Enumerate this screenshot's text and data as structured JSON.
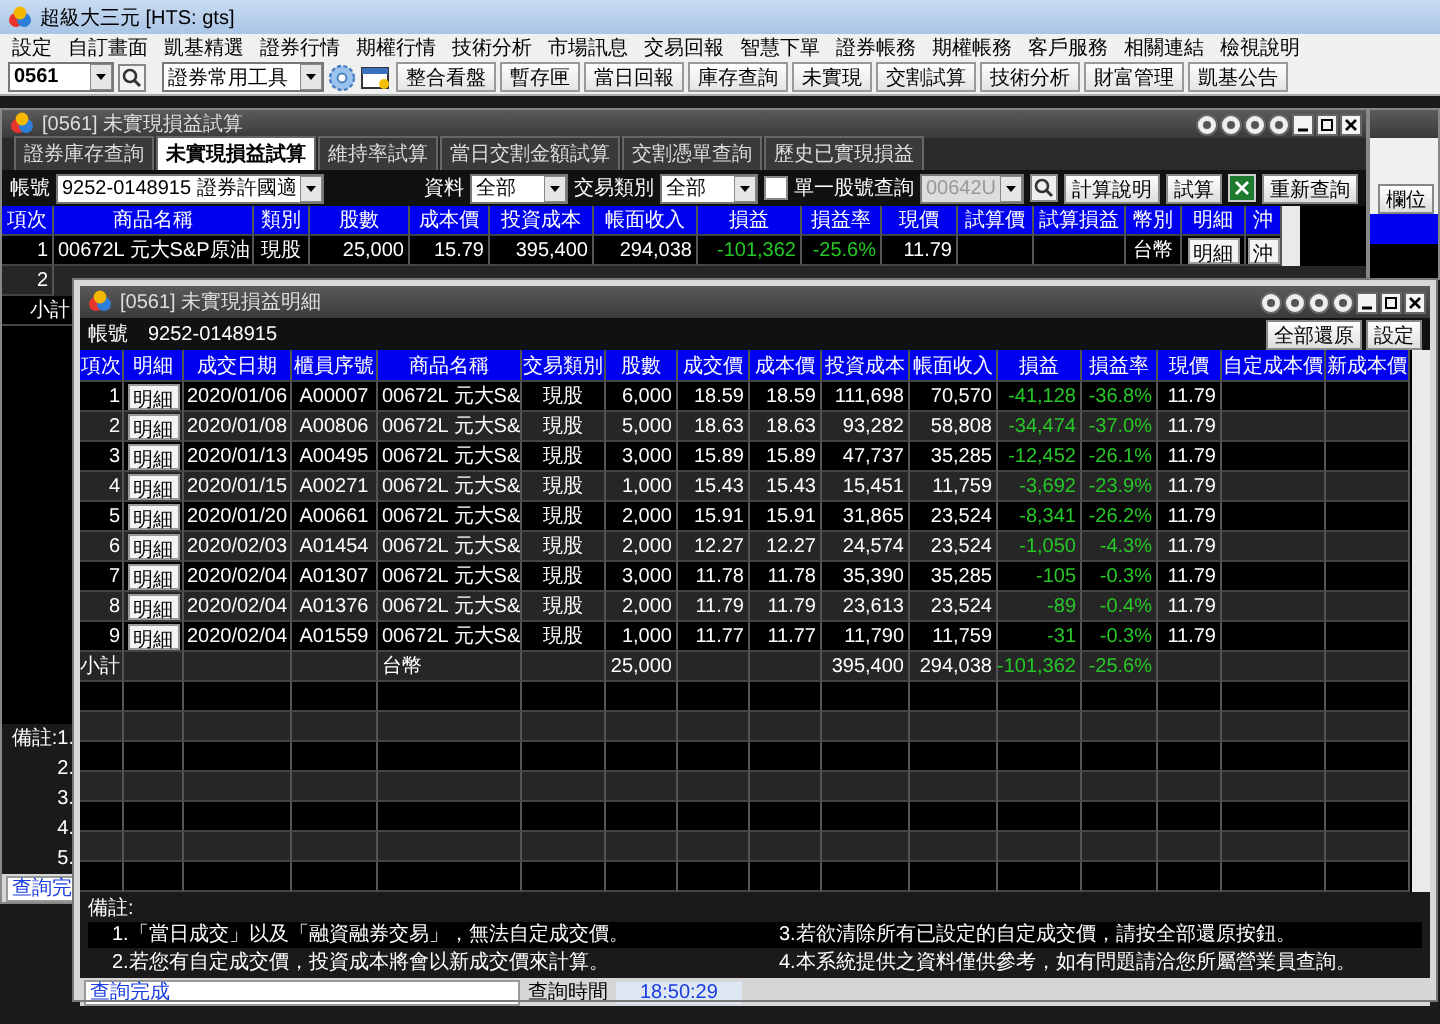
{
  "app": {
    "title": "超級大三元 [HTS: gts]"
  },
  "menu": [
    "設定",
    "自訂畫面",
    "凱基精選",
    "證券行情",
    "期權行情",
    "技術分析",
    "市場訊息",
    "交易回報",
    "智慧下單",
    "證券帳務",
    "期權帳務",
    "客戶服務",
    "相關連結",
    "檢視說明"
  ],
  "toolbar": {
    "account_combo": "0561",
    "tool_combo": "證券常用工具",
    "buttons": [
      "整合看盤",
      "暫存匣",
      "當日回報",
      "庫存查詢",
      "未實現",
      "交割試算",
      "技術分析",
      "財富管理",
      "凱基公告"
    ]
  },
  "back_window": {
    "title": "[0561] 未實現損益試算",
    "tabs": [
      {
        "label": "證券庫存查詢",
        "selected": false
      },
      {
        "label": "未實現損益試算",
        "selected": true
      },
      {
        "label": "維持率試算",
        "selected": false
      },
      {
        "label": "當日交割金額試算",
        "selected": false
      },
      {
        "label": "交割憑單查詢",
        "selected": false
      },
      {
        "label": "歷史已實現損益",
        "selected": false
      }
    ],
    "filters": {
      "account_label": "帳號",
      "account": "9252-0148915 證券許國適",
      "data_label": "資料",
      "data": "全部",
      "type_label": "交易類別",
      "type": "全部",
      "single_query": {
        "label": "單一股號查詢",
        "checked": false
      },
      "stock": {
        "value": "00642U",
        "disabled": true
      },
      "buttons": [
        "計算說明",
        "試算",
        "重新查詢"
      ]
    },
    "table": {
      "columns": [
        "項次",
        "商品名稱",
        "類別",
        "股數",
        "成本價",
        "投資成本",
        "帳面收入",
        "損益",
        "損益率",
        "現價",
        "試算價",
        "試算損益",
        "幣別",
        "明細",
        "沖"
      ],
      "rows": [
        {
          "cells": [
            "1",
            "00672L 元大S&P原油",
            "現股",
            "25,000",
            "15.79",
            "395,400",
            "294,038",
            "-101,362",
            "-25.6%",
            "11.79",
            "",
            "",
            "台幣"
          ],
          "detail_button": "明細",
          "offset_button": "沖"
        }
      ],
      "hidden_row_no": "2",
      "subtotal_label": "小計"
    },
    "notes": [
      "備註:1.",
      "2.",
      "3.",
      "4.",
      "5."
    ],
    "status": "查詢完"
  },
  "side_window": {
    "button": "欄位"
  },
  "detail_window": {
    "title": "[0561] 未實現損益明細",
    "account_label": "帳號",
    "account": "9252-0148915",
    "buttons": [
      "全部還原",
      "設定"
    ],
    "table": {
      "columns": [
        "項次",
        "明細",
        "成交日期",
        "櫃員序號",
        "商品名稱",
        "交易類別",
        "股數",
        "成交價",
        "成本價",
        "投資成本",
        "帳面收入",
        "損益",
        "損益率",
        "現價",
        "自定成本價",
        "新成本價"
      ],
      "rows": [
        {
          "cells": [
            "1",
            "明細",
            "2020/01/06",
            "A00007",
            "00672L 元大S&",
            "現股",
            "6,000",
            "18.59",
            "18.59",
            "111,698",
            "70,570",
            "-41,128",
            "-36.8%",
            "11.79",
            "",
            ""
          ]
        },
        {
          "cells": [
            "2",
            "明細",
            "2020/01/08",
            "A00806",
            "00672L 元大S&",
            "現股",
            "5,000",
            "18.63",
            "18.63",
            "93,282",
            "58,808",
            "-34,474",
            "-37.0%",
            "11.79",
            "",
            ""
          ]
        },
        {
          "cells": [
            "3",
            "明細",
            "2020/01/13",
            "A00495",
            "00672L 元大S&",
            "現股",
            "3,000",
            "15.89",
            "15.89",
            "47,737",
            "35,285",
            "-12,452",
            "-26.1%",
            "11.79",
            "",
            ""
          ]
        },
        {
          "cells": [
            "4",
            "明細",
            "2020/01/15",
            "A00271",
            "00672L 元大S&",
            "現股",
            "1,000",
            "15.43",
            "15.43",
            "15,451",
            "11,759",
            "-3,692",
            "-23.9%",
            "11.79",
            "",
            ""
          ]
        },
        {
          "cells": [
            "5",
            "明細",
            "2020/01/20",
            "A00661",
            "00672L 元大S&",
            "現股",
            "2,000",
            "15.91",
            "15.91",
            "31,865",
            "23,524",
            "-8,341",
            "-26.2%",
            "11.79",
            "",
            ""
          ]
        },
        {
          "cells": [
            "6",
            "明細",
            "2020/02/03",
            "A01454",
            "00672L 元大S&",
            "現股",
            "2,000",
            "12.27",
            "12.27",
            "24,574",
            "23,524",
            "-1,050",
            "-4.3%",
            "11.79",
            "",
            ""
          ]
        },
        {
          "cells": [
            "7",
            "明細",
            "2020/02/04",
            "A01307",
            "00672L 元大S&",
            "現股",
            "3,000",
            "11.78",
            "11.78",
            "35,390",
            "35,285",
            "-105",
            "-0.3%",
            "11.79",
            "",
            ""
          ]
        },
        {
          "cells": [
            "8",
            "明細",
            "2020/02/04",
            "A01376",
            "00672L 元大S&",
            "現股",
            "2,000",
            "11.79",
            "11.79",
            "23,613",
            "23,524",
            "-89",
            "-0.4%",
            "11.79",
            "",
            ""
          ]
        },
        {
          "cells": [
            "9",
            "明細",
            "2020/02/04",
            "A01559",
            "00672L 元大S&",
            "現股",
            "1,000",
            "11.77",
            "11.77",
            "11,790",
            "11,759",
            "-31",
            "-0.3%",
            "11.79",
            "",
            ""
          ]
        },
        {
          "cells": [
            "小計",
            "",
            "",
            "",
            "台幣",
            "",
            "25,000",
            "",
            "",
            "395,400",
            "294,038",
            "-101,362",
            "-25.6%",
            "",
            "",
            ""
          ]
        }
      ]
    },
    "notes_heading": "備註:",
    "notes": [
      "1.「當日成交」以及「融資融券交易」，無法自定成交價。",
      "3.若欲清除所有已設定的自定成交價，請按全部還原按鈕。",
      "2.若您有自定成交價，投資成本將會以新成交價來計算。",
      "4.本系統提供之資料僅供參考，如有問題請洽您所屬營業員查詢。"
    ],
    "status": "查詢完成",
    "time_label": "查詢時間",
    "time": "18:50:29"
  }
}
